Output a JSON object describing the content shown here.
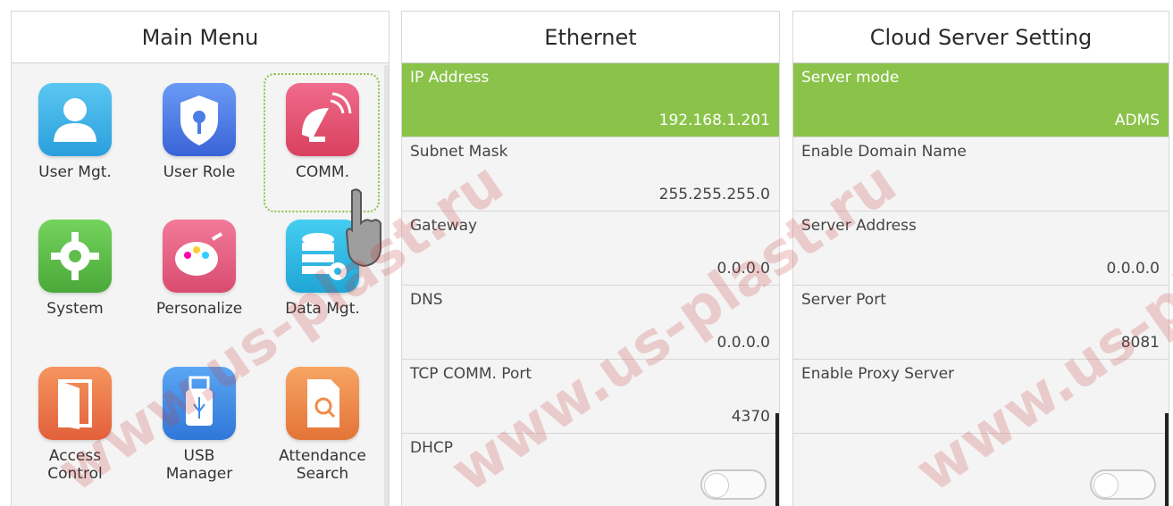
{
  "main_menu": {
    "title": "Main Menu",
    "items": [
      {
        "label": "User Mgt.",
        "icon": "user-icon",
        "color": "#3ab0e8"
      },
      {
        "label": "User Role",
        "icon": "shield-key-icon",
        "color": "#4a7de8"
      },
      {
        "label": "COMM.",
        "icon": "satellite-dish-icon",
        "color": "#e8577a"
      },
      {
        "label": "System",
        "icon": "gear-icon",
        "color": "#5fbf4a"
      },
      {
        "label": "Personalize",
        "icon": "palette-icon",
        "color": "#e85c82"
      },
      {
        "label": "Data Mgt.",
        "icon": "database-icon",
        "color": "#2bb9e3"
      },
      {
        "label": "Access\nControl",
        "icon": "door-icon",
        "color": "#ef7b4c"
      },
      {
        "label": "USB\nManager",
        "icon": "usb-icon",
        "color": "#3b8ee8"
      },
      {
        "label": "Attendance\nSearch",
        "icon": "search-document-icon",
        "color": "#f08b4a"
      }
    ]
  },
  "ethernet": {
    "title": "Ethernet",
    "rows": [
      {
        "label": "IP Address",
        "value": "192.168.1.201"
      },
      {
        "label": "Subnet Mask",
        "value": "255.255.255.0"
      },
      {
        "label": "Gateway",
        "value": "0.0.0.0"
      },
      {
        "label": "DNS",
        "value": "0.0.0.0"
      },
      {
        "label": "TCP COMM. Port",
        "value": "4370"
      },
      {
        "label": "DHCP",
        "value": ""
      }
    ]
  },
  "cloud": {
    "title": "Cloud Server Setting",
    "rows": [
      {
        "label": "Server mode",
        "value": "ADMS"
      },
      {
        "label": "Enable Domain Name",
        "value": ""
      },
      {
        "label": "Server Address",
        "value": "0.0.0.0"
      },
      {
        "label": "Server Port",
        "value": "8081"
      },
      {
        "label": "Enable Proxy Server",
        "value": ""
      },
      {
        "label": "",
        "value": ""
      }
    ]
  },
  "colors": {
    "selected_row": "#8bc34a"
  },
  "watermark": "www.us-plast.ru"
}
